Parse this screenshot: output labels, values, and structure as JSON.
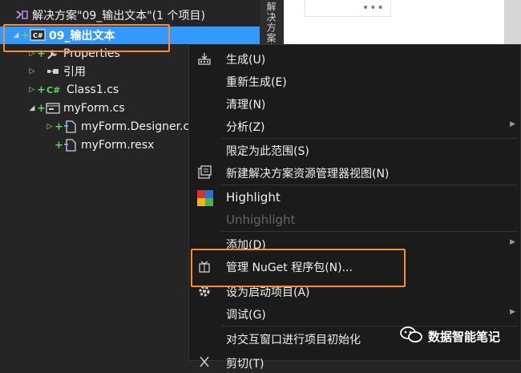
{
  "solution_explorer": {
    "solution_label": "解决方案\"09_输出文本\"(1 个项目)",
    "project_label": "09_输出文本",
    "properties_label": "Properties",
    "references_label": "引用",
    "class1_label": "Class1.cs",
    "myform_label": "myForm.cs",
    "myform_designer_label": "myForm.Designer.cs",
    "myform_resx_label": "myForm.resx",
    "csharp_badge": "C#"
  },
  "vertical_tab": {
    "label": "解决方案资源"
  },
  "context_menu": {
    "items": [
      {
        "label": "生成(U)"
      },
      {
        "label": "重新生成(E)"
      },
      {
        "label": "清理(N)"
      },
      {
        "label": "分析(Z)"
      },
      {
        "label": "限定为此范围(S)"
      },
      {
        "label": "新建解决方案资源管理器视图(N)"
      },
      {
        "label": "Highlight"
      },
      {
        "label": "Unhighlight"
      },
      {
        "label": "添加(D)"
      },
      {
        "label": "管理 NuGet 程序包(N)..."
      },
      {
        "label": "设为启动项目(A)"
      },
      {
        "label": "调试(G)"
      },
      {
        "label": "对交互窗口进行项目初始化"
      },
      {
        "label": "剪切(T)"
      }
    ]
  },
  "watermark": {
    "text": "数据智能笔记"
  },
  "colors": {
    "highlight_box": "#ff8b2e",
    "selection": "#3399ff",
    "menu_bg": "#1b1b1c"
  }
}
